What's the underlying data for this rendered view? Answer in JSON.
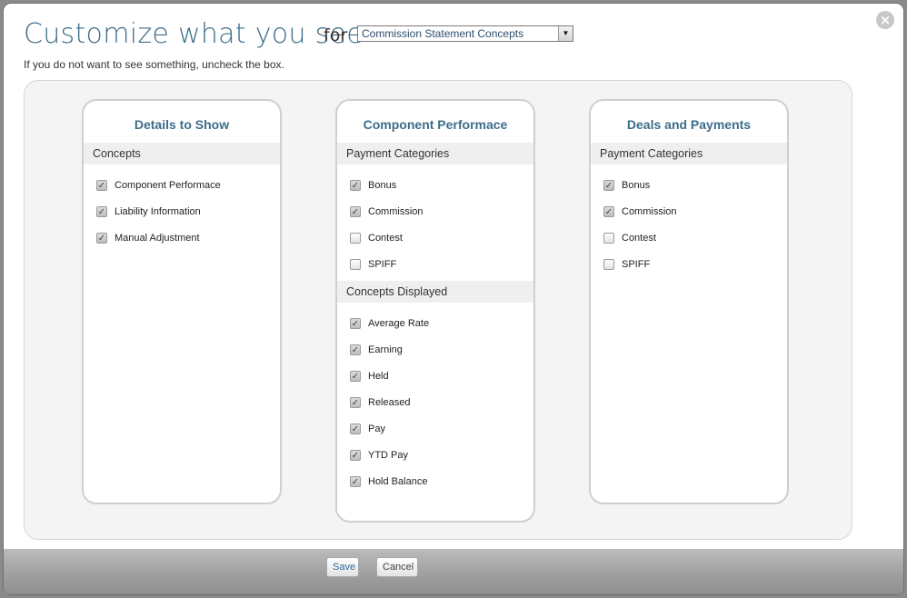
{
  "header": {
    "title": "Customize what you see",
    "for_label": "for",
    "select_value": "Commission Statement Concepts",
    "close_icon": "close-icon",
    "subtitle": "If you do not want to see something, uncheck the box."
  },
  "cards": [
    {
      "title": "Details to Show",
      "groups": [
        {
          "heading": "Concepts",
          "items": [
            {
              "label": "Component Performace",
              "checked": true
            },
            {
              "label": "Liability Information",
              "checked": true
            },
            {
              "label": "Manual Adjustment",
              "checked": true
            }
          ]
        }
      ]
    },
    {
      "title": "Component Performace",
      "groups": [
        {
          "heading": "Payment Categories",
          "items": [
            {
              "label": "Bonus",
              "checked": true
            },
            {
              "label": "Commission",
              "checked": true
            },
            {
              "label": "Contest",
              "checked": false
            },
            {
              "label": "SPIFF",
              "checked": false
            }
          ]
        },
        {
          "heading": "Concepts Displayed",
          "items": [
            {
              "label": "Average Rate",
              "checked": true
            },
            {
              "label": "Earning",
              "checked": true
            },
            {
              "label": "Held",
              "checked": true
            },
            {
              "label": "Released",
              "checked": true
            },
            {
              "label": "Pay",
              "checked": true
            },
            {
              "label": "YTD Pay",
              "checked": true
            },
            {
              "label": "Hold Balance",
              "checked": true
            }
          ]
        }
      ]
    },
    {
      "title": "Deals and Payments",
      "groups": [
        {
          "heading": "Payment Categories",
          "items": [
            {
              "label": "Bonus",
              "checked": true
            },
            {
              "label": "Commission",
              "checked": true
            },
            {
              "label": "Contest",
              "checked": false
            },
            {
              "label": "SPIFF",
              "checked": false
            }
          ]
        }
      ]
    }
  ],
  "footer": {
    "save_label": "Save",
    "cancel_label": "Cancel"
  },
  "colors": {
    "accent": "#3d6d8a",
    "save_text": "#2f6a9a"
  }
}
